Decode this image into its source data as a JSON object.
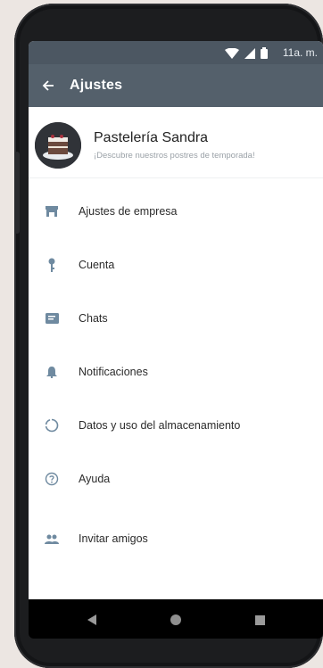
{
  "status_bar": {
    "time": "11a. m."
  },
  "app_bar": {
    "title": "Ajustes"
  },
  "profile": {
    "name": "Pastelería Sandra",
    "status": "¡Descubre nuestros postres de temporada!"
  },
  "menu": [
    {
      "label": "Ajustes de empresa",
      "icon": "store-icon"
    },
    {
      "label": "Cuenta",
      "icon": "key-icon"
    },
    {
      "label": "Chats",
      "icon": "chat-icon"
    },
    {
      "label": "Notificaciones",
      "icon": "bell-icon"
    },
    {
      "label": "Datos y uso del almacenamiento",
      "icon": "data-usage-icon"
    },
    {
      "label": "Ayuda",
      "icon": "help-icon"
    },
    {
      "label": "Invitar amigos",
      "icon": "people-icon"
    }
  ],
  "colors": {
    "app_bar": "#54606b",
    "status_bar": "#4c5762",
    "icon": "#6f8aa0"
  }
}
